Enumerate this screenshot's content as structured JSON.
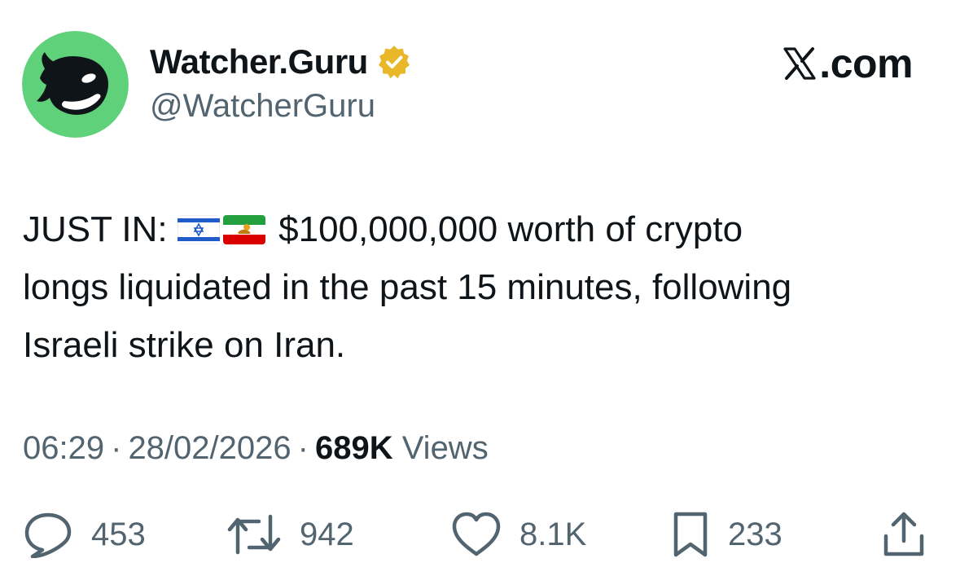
{
  "author": {
    "display_name": "Watcher.Guru",
    "handle": "@WatcherGuru",
    "verified": true,
    "avatar_icon": "whale-icon",
    "avatar_color": "#5fd17a"
  },
  "site": {
    "logo_icon": "x-logo-icon",
    "suffix": ".com"
  },
  "tweet": {
    "prefix": "JUST IN:",
    "flags": [
      "israel-flag-icon",
      "iran-lion-and-sun-flag-icon"
    ],
    "line1_rest": "$100,000,000 worth of crypto",
    "line2": "longs liquidated in the past 15 minutes, following",
    "line3": "Israeli strike on Iran."
  },
  "meta": {
    "time": "06:29",
    "separator": "·",
    "date": "28/02/2026",
    "views_count": "689K",
    "views_label": "Views"
  },
  "actions": {
    "reply_count": "453",
    "repost_count": "942",
    "like_count": "8.1K",
    "bookmark_count": "233"
  },
  "colors": {
    "text": "#0f1419",
    "secondary": "#536471",
    "verified_gold": "#e8b829"
  }
}
